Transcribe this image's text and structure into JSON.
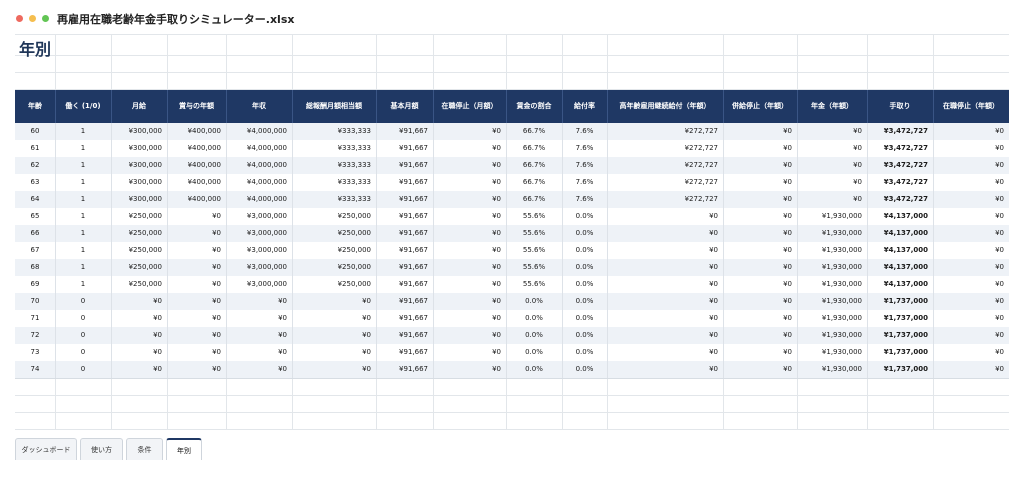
{
  "window": {
    "title": "再雇用在職老齢年金手取りシミュレーター.xlsx"
  },
  "sheet": {
    "title": "年別"
  },
  "table": {
    "columns": [
      "年齢",
      "働く (1/0)",
      "月給",
      "賞与の年額",
      "年収",
      "総報酬月額相当額",
      "基本月額",
      "在職停止（月額）",
      "賃金の割合",
      "給付率",
      "高年齢雇用継続給付（年額）",
      "併給停止（年額）",
      "年金（年額）",
      "手取り",
      "在職停止（年額）"
    ],
    "rows": [
      [
        "60",
        "1",
        "¥300,000",
        "¥400,000",
        "¥4,000,000",
        "¥333,333",
        "¥91,667",
        "¥0",
        "66.7%",
        "7.6%",
        "¥272,727",
        "¥0",
        "¥0",
        "¥3,472,727",
        "¥0"
      ],
      [
        "61",
        "1",
        "¥300,000",
        "¥400,000",
        "¥4,000,000",
        "¥333,333",
        "¥91,667",
        "¥0",
        "66.7%",
        "7.6%",
        "¥272,727",
        "¥0",
        "¥0",
        "¥3,472,727",
        "¥0"
      ],
      [
        "62",
        "1",
        "¥300,000",
        "¥400,000",
        "¥4,000,000",
        "¥333,333",
        "¥91,667",
        "¥0",
        "66.7%",
        "7.6%",
        "¥272,727",
        "¥0",
        "¥0",
        "¥3,472,727",
        "¥0"
      ],
      [
        "63",
        "1",
        "¥300,000",
        "¥400,000",
        "¥4,000,000",
        "¥333,333",
        "¥91,667",
        "¥0",
        "66.7%",
        "7.6%",
        "¥272,727",
        "¥0",
        "¥0",
        "¥3,472,727",
        "¥0"
      ],
      [
        "64",
        "1",
        "¥300,000",
        "¥400,000",
        "¥4,000,000",
        "¥333,333",
        "¥91,667",
        "¥0",
        "66.7%",
        "7.6%",
        "¥272,727",
        "¥0",
        "¥0",
        "¥3,472,727",
        "¥0"
      ],
      [
        "65",
        "1",
        "¥250,000",
        "¥0",
        "¥3,000,000",
        "¥250,000",
        "¥91,667",
        "¥0",
        "55.6%",
        "0.0%",
        "¥0",
        "¥0",
        "¥1,930,000",
        "¥4,137,000",
        "¥0"
      ],
      [
        "66",
        "1",
        "¥250,000",
        "¥0",
        "¥3,000,000",
        "¥250,000",
        "¥91,667",
        "¥0",
        "55.6%",
        "0.0%",
        "¥0",
        "¥0",
        "¥1,930,000",
        "¥4,137,000",
        "¥0"
      ],
      [
        "67",
        "1",
        "¥250,000",
        "¥0",
        "¥3,000,000",
        "¥250,000",
        "¥91,667",
        "¥0",
        "55.6%",
        "0.0%",
        "¥0",
        "¥0",
        "¥1,930,000",
        "¥4,137,000",
        "¥0"
      ],
      [
        "68",
        "1",
        "¥250,000",
        "¥0",
        "¥3,000,000",
        "¥250,000",
        "¥91,667",
        "¥0",
        "55.6%",
        "0.0%",
        "¥0",
        "¥0",
        "¥1,930,000",
        "¥4,137,000",
        "¥0"
      ],
      [
        "69",
        "1",
        "¥250,000",
        "¥0",
        "¥3,000,000",
        "¥250,000",
        "¥91,667",
        "¥0",
        "55.6%",
        "0.0%",
        "¥0",
        "¥0",
        "¥1,930,000",
        "¥4,137,000",
        "¥0"
      ],
      [
        "70",
        "0",
        "¥0",
        "¥0",
        "¥0",
        "¥0",
        "¥91,667",
        "¥0",
        "0.0%",
        "0.0%",
        "¥0",
        "¥0",
        "¥1,930,000",
        "¥1,737,000",
        "¥0"
      ],
      [
        "71",
        "0",
        "¥0",
        "¥0",
        "¥0",
        "¥0",
        "¥91,667",
        "¥0",
        "0.0%",
        "0.0%",
        "¥0",
        "¥0",
        "¥1,930,000",
        "¥1,737,000",
        "¥0"
      ],
      [
        "72",
        "0",
        "¥0",
        "¥0",
        "¥0",
        "¥0",
        "¥91,667",
        "¥0",
        "0.0%",
        "0.0%",
        "¥0",
        "¥0",
        "¥1,930,000",
        "¥1,737,000",
        "¥0"
      ],
      [
        "73",
        "0",
        "¥0",
        "¥0",
        "¥0",
        "¥0",
        "¥91,667",
        "¥0",
        "0.0%",
        "0.0%",
        "¥0",
        "¥0",
        "¥1,930,000",
        "¥1,737,000",
        "¥0"
      ],
      [
        "74",
        "0",
        "¥0",
        "¥0",
        "¥0",
        "¥0",
        "¥91,667",
        "¥0",
        "0.0%",
        "0.0%",
        "¥0",
        "¥0",
        "¥1,930,000",
        "¥1,737,000",
        "¥0"
      ]
    ]
  },
  "tabs": [
    {
      "label": "ダッシュボード"
    },
    {
      "label": "使い方"
    },
    {
      "label": "条件"
    },
    {
      "label": "年別"
    }
  ],
  "colors": {
    "header_bg": "#1f3864",
    "row_alt": "#eef2f7",
    "title": "#1e3557"
  }
}
